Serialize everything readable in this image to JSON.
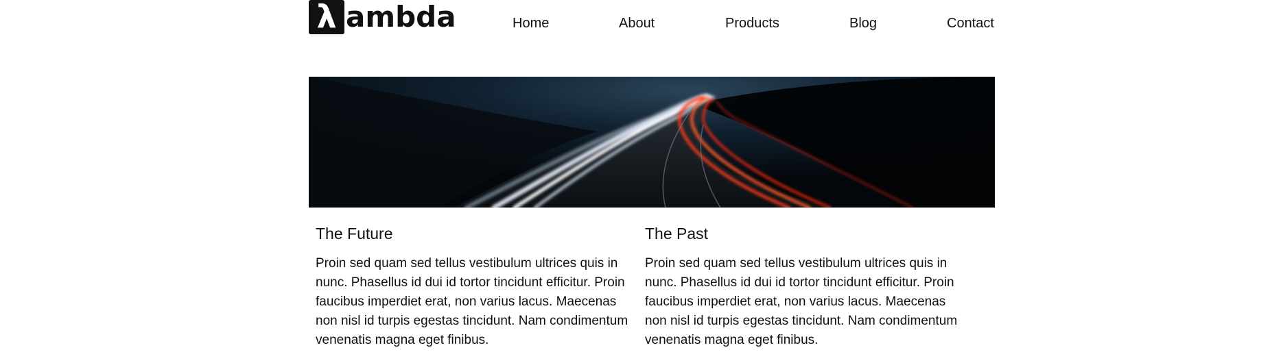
{
  "header": {
    "logo_symbol": "λ",
    "logo_text": "ambda",
    "nav": {
      "home": "Home",
      "about": "About",
      "products": "Products",
      "blog": "Blog",
      "contact": "Contact"
    }
  },
  "hero": {
    "image": "night-highway-light-trails"
  },
  "columns": [
    {
      "title": "The Future",
      "body": "Proin sed quam sed tellus vestibulum ultrices quis in nunc. Phasellus id dui id tortor tincidunt efficitur. Proin faucibus imperdiet erat, non varius lacus. Maecenas non nisl id turpis egestas tincidunt. Nam condimentum venenatis magna eget finibus."
    },
    {
      "title": "The Past",
      "body": "Proin sed quam sed tellus vestibulum ultrices quis in nunc. Phasellus id dui id tortor tincidunt efficitur. Proin faucibus imperdiet erat, non varius lacus. Maecenas non nisl id turpis egestas tincidunt. Nam condimentum venenatis magna eget finibus."
    }
  ],
  "colors": {
    "text": "#111111",
    "background": "#ffffff",
    "trail_white": "#e8f0ff",
    "trail_red": "#ff3a1a"
  }
}
